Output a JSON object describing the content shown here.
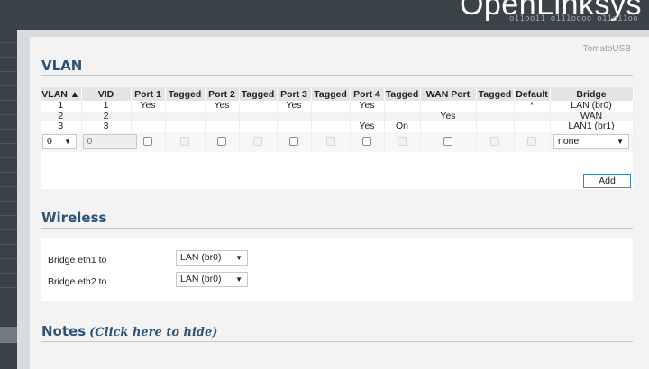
{
  "header": {
    "logo_text": "OpenLinksys",
    "logo_sub": "o11oo11 o111oooo o11o11oo"
  },
  "brand": "TomatoUSB",
  "vlan": {
    "title": "VLAN",
    "headers": [
      "VLAN ▲",
      "VID",
      "Port 1",
      "Tagged",
      "Port 2",
      "Tagged",
      "Port 3",
      "Tagged",
      "Port 4",
      "Tagged",
      "WAN Port",
      "Tagged",
      "Default",
      "Bridge"
    ],
    "rows": [
      [
        "1",
        "1",
        "Yes",
        "",
        "Yes",
        "",
        "Yes",
        "",
        "Yes",
        "",
        "",
        "",
        "*",
        "LAN (br0)"
      ],
      [
        "2",
        "2",
        "",
        "",
        "",
        "",
        "",
        "",
        "",
        "",
        "Yes",
        "",
        "",
        "WAN"
      ],
      [
        "3",
        "3",
        "",
        "",
        "",
        "",
        "",
        "",
        "Yes",
        "On",
        "",
        "",
        "",
        "LAN1 (br1)"
      ]
    ],
    "new_row": {
      "vlan_select": "0",
      "vid_input": "0",
      "bridge_select": "none"
    },
    "add_label": "Add"
  },
  "wireless": {
    "title": "Wireless",
    "rows": [
      {
        "label": "Bridge eth1 to",
        "value": "LAN (br0)"
      },
      {
        "label": "Bridge eth2 to",
        "value": "LAN (br0)"
      }
    ]
  },
  "notes": {
    "title": "Notes",
    "link": "(Click here to hide)"
  },
  "icons": {
    "dropdown": "chevron-down-icon"
  }
}
